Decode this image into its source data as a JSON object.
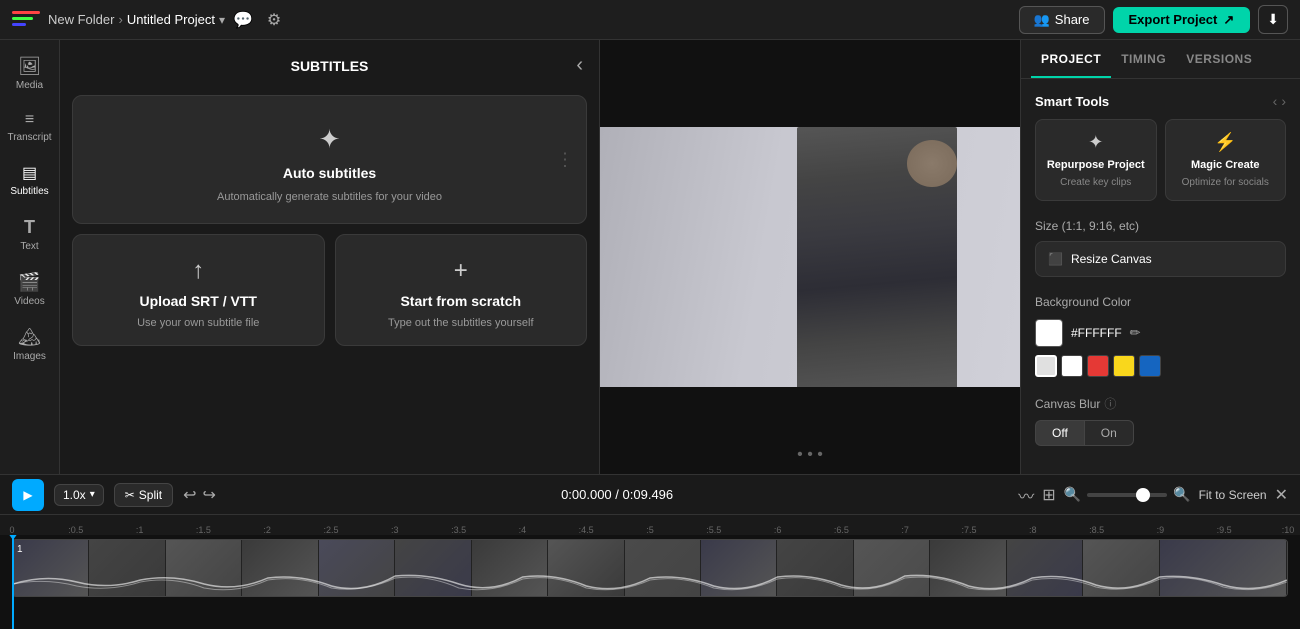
{
  "topbar": {
    "logo_label": "Logo",
    "folder": "New Folder",
    "separator": "›",
    "project": "Untitled Project",
    "dropdown_icon": "▾",
    "share_label": "Share",
    "export_label": "Export Project",
    "download_icon": "⬇"
  },
  "sidebar": {
    "items": [
      {
        "id": "media",
        "label": "Media",
        "icon": "🖼"
      },
      {
        "id": "transcript",
        "label": "Transcript",
        "icon": "≡"
      },
      {
        "id": "subtitles",
        "label": "Subtitles",
        "icon": "▤",
        "active": true
      },
      {
        "id": "text",
        "label": "Text",
        "icon": "T"
      },
      {
        "id": "videos",
        "label": "Videos",
        "icon": "⬛"
      },
      {
        "id": "images",
        "label": "Images",
        "icon": "🏔"
      }
    ]
  },
  "subtitles_panel": {
    "title": "SUBTITLES",
    "collapse_icon": "‹",
    "auto": {
      "icon": "✦",
      "title": "Auto subtitles",
      "desc": "Automatically generate subtitles for your video"
    },
    "upload": {
      "icon": "↑",
      "title": "Upload SRT / VTT",
      "desc": "Use your own subtitle file"
    },
    "scratch": {
      "icon": "+",
      "title": "Start from scratch",
      "desc": "Type out the subtitles yourself"
    },
    "more_icon": "⋮"
  },
  "right_panel": {
    "tabs": [
      {
        "id": "project",
        "label": "PROJECT",
        "active": true
      },
      {
        "id": "timing",
        "label": "TIMING"
      },
      {
        "id": "versions",
        "label": "VERSIONS"
      }
    ],
    "smart_tools_title": "Smart Tools",
    "smart_tools": [
      {
        "id": "repurpose",
        "icon": "✦",
        "name": "Repurpose Project",
        "desc": "Create key clips"
      },
      {
        "id": "magic",
        "icon": "⚡",
        "name": "Magic Create",
        "desc": "Optimize for socials"
      }
    ],
    "size_label": "Size (1:1, 9:16, etc)",
    "resize_label": "Resize Canvas",
    "bg_color_label": "Background Color",
    "bg_color_hex": "#FFFFFF",
    "bg_swatches": [
      {
        "color": "#e0e0e0",
        "selected": true
      },
      {
        "color": "#ffffff"
      },
      {
        "color": "#e53935"
      },
      {
        "color": "#f9d71c"
      },
      {
        "color": "#1565c0"
      }
    ],
    "canvas_blur_label": "Canvas Blur",
    "blur_off": "Off",
    "blur_on": "On"
  },
  "timeline": {
    "play_icon": "▶",
    "speed": "1.0x",
    "split_icon": "✂",
    "split_label": "Split",
    "undo_icon": "↩",
    "redo_icon": "↪",
    "timecode": "0:00.000",
    "separator": "/",
    "duration": "0:09.496",
    "fit_screen_label": "Fit to Screen",
    "close_icon": "✕",
    "ruler_marks": [
      "0",
      ":0.5",
      ":1",
      ":1.5",
      ":2",
      ":2.5",
      ":3",
      ":3.5",
      ":4",
      ":4.5",
      ":5",
      ":5.5",
      ":6",
      ":6.5",
      ":7",
      ":7.5",
      ":8",
      ":8.5",
      ":9",
      ":9.5",
      ":10"
    ]
  }
}
